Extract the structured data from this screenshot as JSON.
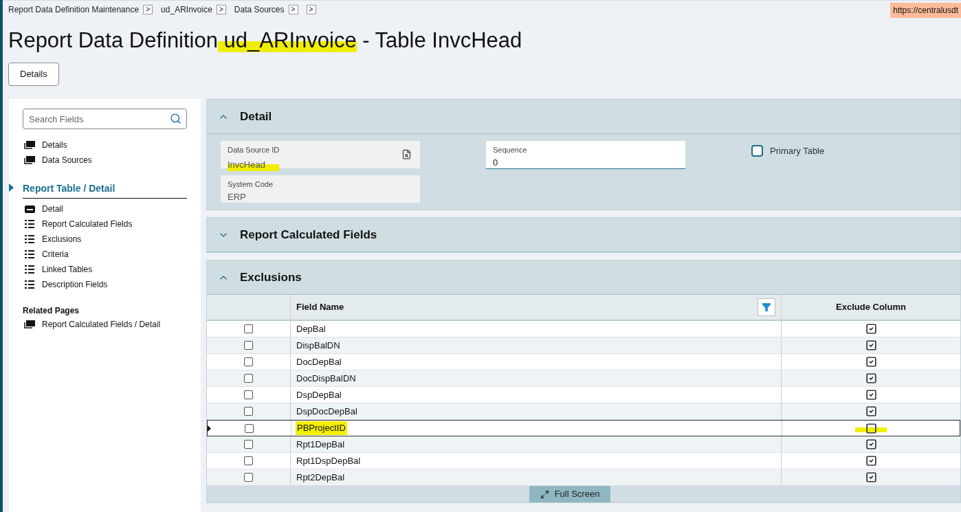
{
  "breadcrumbs": [
    {
      "label": "Report Data Definition Maintenance",
      "chevron": ">"
    },
    {
      "label": "ud_ARInvoice",
      "chevron": ">"
    },
    {
      "label": "Data Sources",
      "chevron": ">"
    },
    {
      "chevron": ">"
    }
  ],
  "url_tooltip": "https://centralusdt",
  "title": {
    "parts": [
      {
        "text": "Report Data Definition",
        "highlighted": false
      },
      {
        "text": "ud_ARInvoice",
        "highlighted": true
      },
      {
        "text": "- Table InvcHead",
        "highlighted": false
      }
    ]
  },
  "details_button": "Details",
  "sidebar": {
    "search": {
      "placeholder": "Search Fields"
    },
    "top_items": [
      {
        "label": "Details",
        "kind": "cards"
      },
      {
        "label": "Data Sources",
        "kind": "cards"
      }
    ],
    "section": {
      "title": "Report Table / Detail",
      "expanded": true
    },
    "section_items": [
      {
        "label": "Detail",
        "kind": "card"
      },
      {
        "label": "Report Calculated Fields",
        "kind": "list"
      },
      {
        "label": "Exclusions",
        "kind": "list"
      },
      {
        "label": "Criteria",
        "kind": "list"
      },
      {
        "label": "Linked Tables",
        "kind": "list"
      },
      {
        "label": "Description Fields",
        "kind": "list"
      }
    ],
    "related_title": "Related Pages",
    "related_items": [
      {
        "label": "Report Calculated Fields / Detail",
        "kind": "cards"
      }
    ]
  },
  "panels": {
    "detail": {
      "title": "Detail",
      "expanded": true,
      "data_source_id": {
        "label": "Data Source ID",
        "value": "InvcHead",
        "highlighted": true
      },
      "system_code": {
        "label": "System Code",
        "value": "ERP"
      },
      "sequence": {
        "label": "Sequence",
        "value": "0"
      },
      "primary_table": {
        "label": "Primary Table",
        "checked": false
      }
    },
    "calculated": {
      "title": "Report Calculated Fields",
      "expanded": false
    },
    "exclusions": {
      "title": "Exclusions",
      "expanded": true,
      "columns": [
        "Field Name",
        "Exclude Column"
      ],
      "rows": [
        {
          "field_name": "DepBal",
          "checked": false,
          "exclude": true,
          "selected": false,
          "highlighted": false
        },
        {
          "field_name": "DispBalDN",
          "checked": false,
          "exclude": true,
          "selected": false,
          "highlighted": false
        },
        {
          "field_name": "DocDepBal",
          "checked": false,
          "exclude": true,
          "selected": false,
          "highlighted": false
        },
        {
          "field_name": "DocDispBalDN",
          "checked": false,
          "exclude": true,
          "selected": false,
          "highlighted": false
        },
        {
          "field_name": "DspDepBal",
          "checked": false,
          "exclude": true,
          "selected": false,
          "highlighted": false
        },
        {
          "field_name": "DspDocDepBal",
          "checked": false,
          "exclude": true,
          "selected": false,
          "highlighted": false
        },
        {
          "field_name": "PBProjectID",
          "checked": false,
          "exclude": false,
          "selected": true,
          "highlighted": true
        },
        {
          "field_name": "Rpt1DepBal",
          "checked": false,
          "exclude": true,
          "selected": false,
          "highlighted": false
        },
        {
          "field_name": "Rpt1DspDepBal",
          "checked": false,
          "exclude": true,
          "selected": false,
          "highlighted": false
        },
        {
          "field_name": "Rpt2DepBal",
          "checked": false,
          "exclude": true,
          "selected": false,
          "highlighted": false
        }
      ],
      "full_screen": "Full Screen"
    }
  }
}
